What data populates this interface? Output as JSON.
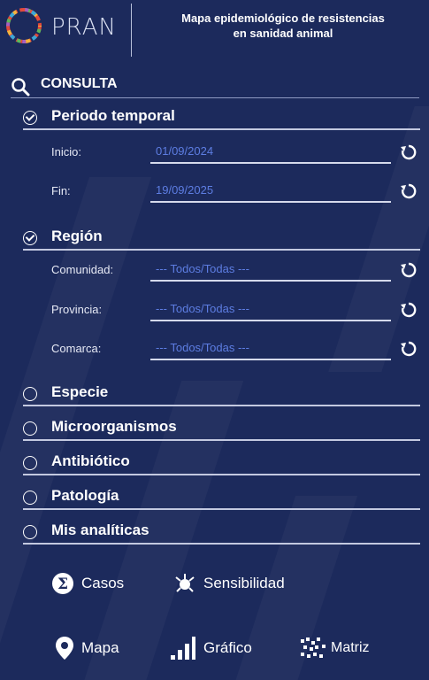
{
  "header": {
    "logo_text": "PRAN",
    "title_line1": "Mapa epidemiológico de resistencias",
    "title_line2": "en sanidad animal"
  },
  "consulta": {
    "label": "CONSULTA",
    "icon": "search-icon"
  },
  "periodo": {
    "label": "Periodo temporal",
    "checked": true,
    "inicio": {
      "label": "Inicio:",
      "value": "01/09/2024"
    },
    "fin": {
      "label": "Fin:",
      "value": "19/09/2025"
    }
  },
  "region": {
    "label": "Región",
    "checked": true,
    "comunidad": {
      "label": "Comunidad:",
      "value": "--- Todos/Todas ---"
    },
    "provincia": {
      "label": "Provincia:",
      "value": "--- Todos/Todas ---"
    },
    "comarca": {
      "label": "Comarca:",
      "value": "--- Todos/Todas ---"
    }
  },
  "filters": [
    {
      "label": "Especie",
      "checked": false
    },
    {
      "label": "Microorganismos",
      "checked": false
    },
    {
      "label": "Antibiótico",
      "checked": false
    },
    {
      "label": "Patología",
      "checked": false
    },
    {
      "label": "Mis analíticas",
      "checked": false
    }
  ],
  "actions": {
    "casos": "Casos",
    "sensibilidad": "Sensibilidad",
    "mapa": "Mapa",
    "grafico": "Gráfico",
    "matriz": "Matriz"
  },
  "colors": {
    "background": "#1c2a5c",
    "field_text": "#5d7de2",
    "text": "#ffffff"
  }
}
